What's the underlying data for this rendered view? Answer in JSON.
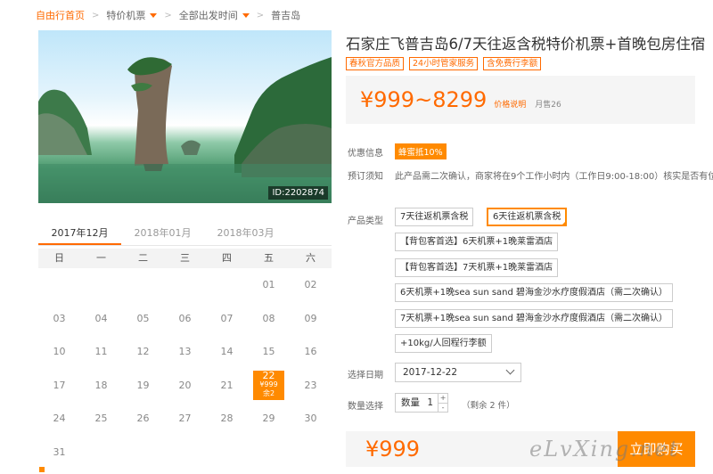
{
  "breadcrumb": {
    "home": "自由行首页",
    "crumb2": "特价机票",
    "crumb3": "全部出发时间",
    "crumb4": "普吉岛"
  },
  "hero": {
    "id_label": "ID:2202874"
  },
  "calendar": {
    "months": [
      "2017年12月",
      "2018年01月",
      "2018年03月"
    ],
    "weekdays": [
      "日",
      "一",
      "二",
      "三",
      "四",
      "五",
      "六"
    ],
    "days": [
      "",
      "",
      "",
      "",
      "",
      "01",
      "02",
      "03",
      "04",
      "05",
      "06",
      "07",
      "08",
      "09",
      "10",
      "11",
      "12",
      "13",
      "14",
      "15",
      "16",
      "17",
      "18",
      "19",
      "20",
      "21",
      "",
      "23",
      "24",
      "25",
      "26",
      "27",
      "28",
      "29",
      "30",
      "31"
    ],
    "selected": {
      "day": "22",
      "price": "¥999",
      "remain": "余2"
    }
  },
  "product": {
    "title": "石家庄飞普吉岛6/7天往返含税特价机票+首晚包房住宿",
    "tags": [
      "春秋官方品质",
      "24小时管家服务",
      "含免费行李额"
    ],
    "price_range": "¥999~8299",
    "price_note": "价格说明",
    "sales": "月售26"
  },
  "info": {
    "promo_label": "优惠信息",
    "promo_badge": "蜂蜜抵10%",
    "notice_label": "预订须知",
    "notice_text": "此产品需二次确认，商家将在9个工作小时内（工作日9:00-18:00）核实是否有位。"
  },
  "options": {
    "label": "产品类型",
    "items": [
      "7天往返机票含税",
      "6天往返机票含税",
      "【背包客首选】6天机票+1晚莱雷酒店",
      "【背包客首选】7天机票+1晚莱雷酒店",
      "6天机票+1晚sea sun sand 碧海金沙水疗度假酒店（需二次确认）",
      "7天机票+1晚sea sun sand 碧海金沙水疗度假酒店（需二次确认）",
      "+10kg/人回程行李额"
    ]
  },
  "date": {
    "label": "选择日期",
    "value": "2017-12-22"
  },
  "quantity": {
    "label": "数量选择",
    "field_label": "数量",
    "value": "1",
    "plus": "+",
    "minus": "-",
    "stock": "（剩余 2 件）"
  },
  "buy": {
    "price": "¥999",
    "button": "立即购买"
  },
  "watermark": "eLvXing.net",
  "colors": {
    "accent": "#ff6a00",
    "button": "#ff8a00"
  }
}
